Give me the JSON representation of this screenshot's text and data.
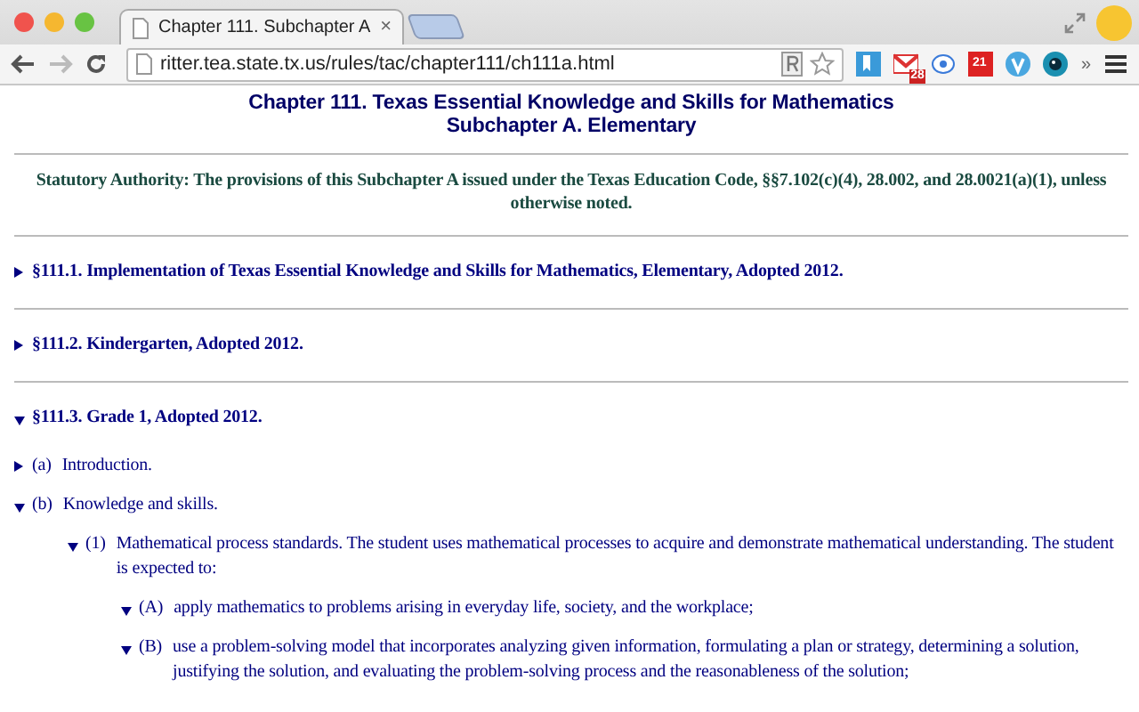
{
  "browser": {
    "tab": {
      "title": "Chapter 111. Subchapter A",
      "close": "×"
    },
    "url": "ritter.tea.state.tx.us/rules/tac/chapter111/ch111a.html",
    "extension_badges": [
      {
        "kind": "mail",
        "badge": "28"
      },
      {
        "kind": "calendar",
        "badge": "21"
      }
    ],
    "overflow": "»"
  },
  "page": {
    "title_lines": [
      "Chapter 111. Texas Essential Knowledge and Skills for Mathematics",
      "Subchapter A. Elementary"
    ],
    "authority": "Statutory Authority: The provisions of this Subchapter A issued under the Texas Education Code, §§7.102(c)(4), 28.002, and 28.0021(a)(1), unless otherwise noted.",
    "sections": [
      {
        "text": "§111.1. Implementation of Texas Essential Knowledge and Skills for Mathematics, Elementary, Adopted 2012.",
        "expanded": false
      },
      {
        "text": "§111.2. Kindergarten, Adopted 2012.",
        "expanded": false
      },
      {
        "text": "§111.3. Grade 1, Adopted 2012.",
        "expanded": true,
        "children": [
          {
            "label": "(a)",
            "text": "Introduction.",
            "expanded": false
          },
          {
            "label": "(b)",
            "text": "Knowledge and skills.",
            "expanded": true,
            "children": [
              {
                "label": "(1)",
                "text": "Mathematical process standards. The student uses mathematical processes to acquire and demonstrate mathematical understanding. The student is expected to:",
                "expanded": true,
                "children": [
                  {
                    "label": "(A)",
                    "text": "apply mathematics to problems arising in everyday life, society, and the workplace;",
                    "expanded": true
                  },
                  {
                    "label": "(B)",
                    "text": "use a problem-solving model that incorporates analyzing given information, formulating a plan or strategy, determining a solution, justifying the solution, and evaluating the problem-solving process and the reasonableness of the solution;",
                    "expanded": true
                  }
                ]
              }
            ]
          }
        ]
      }
    ]
  }
}
